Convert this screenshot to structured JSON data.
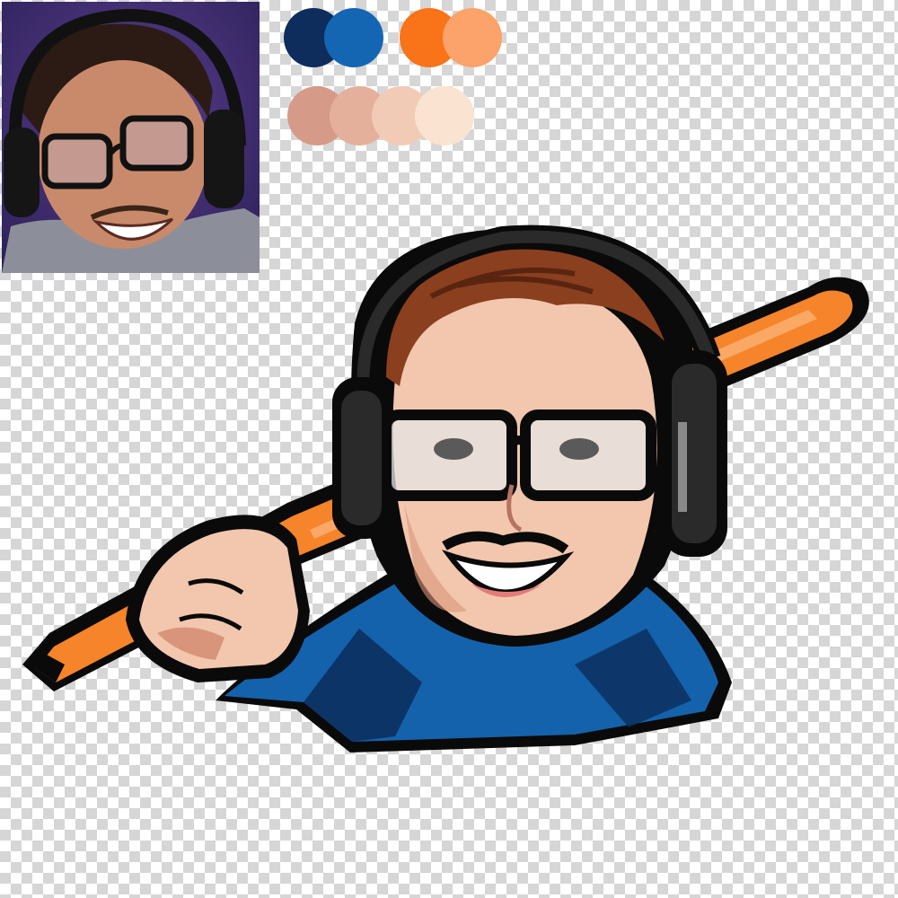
{
  "canvas": {
    "background": "transparency-checkerboard"
  },
  "reference_photo": {
    "description_icon": "photo-icon",
    "subject": "person-with-headset-and-glasses",
    "colors": {
      "background": "#3a2d6e",
      "skin": "#c98a6b",
      "hair": "#2b1b14",
      "shirt": "#8c8f9a"
    }
  },
  "palette": {
    "row1": [
      "#0e2c5c",
      "#1466b3",
      "#f97318",
      "#fba36a"
    ],
    "row2": [
      "#d69a88",
      "#e4b09c",
      "#f1cbb5",
      "#fbe3d2"
    ]
  },
  "mascot": {
    "icon": "gamer-mascot-illustration",
    "colors": {
      "outline": "#0a0a0a",
      "skin": "#f2c7ad",
      "skin_shadow": "#d9957c",
      "hair": "#8a3f1f",
      "hoodie": "#1462ab",
      "hoodie_dark": "#0b2d5a",
      "bat": "#f6842a",
      "bat_light": "#fbb174",
      "headset": "#2a2a2a",
      "lens": "#e6e6e6"
    }
  }
}
